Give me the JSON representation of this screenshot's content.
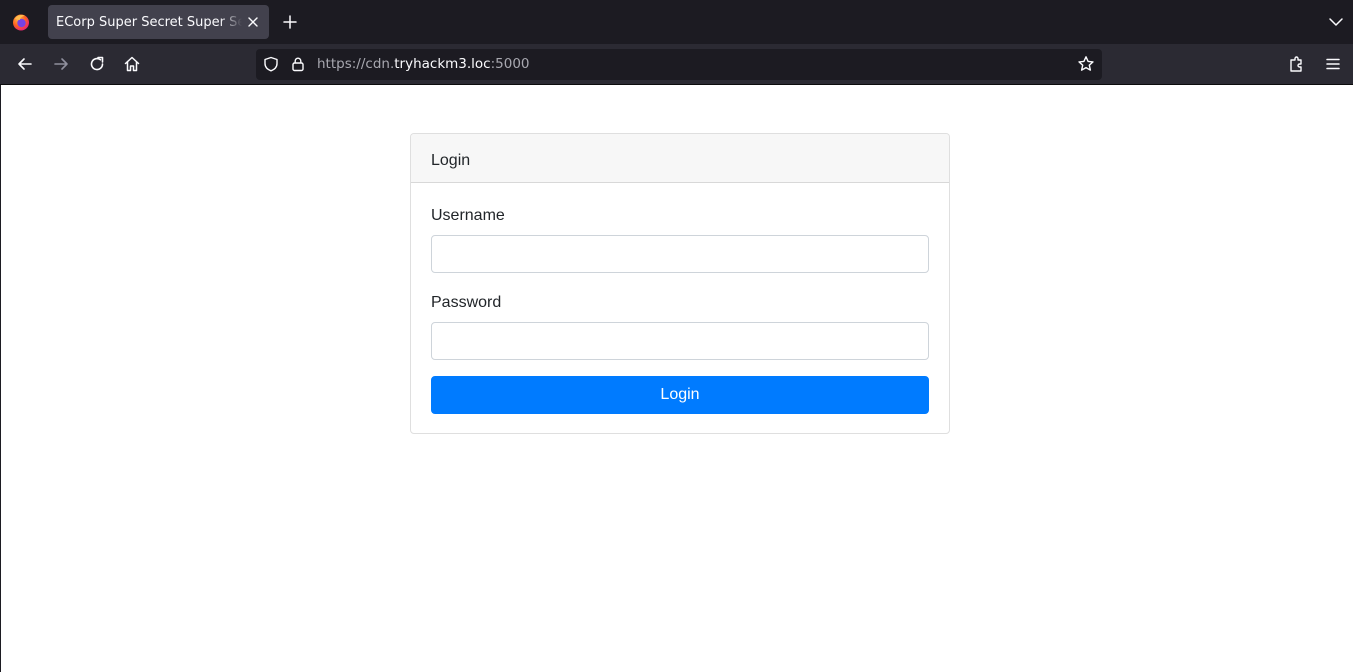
{
  "browser": {
    "tab_title": "ECorp Super Secret Super Secret",
    "url_prefix": "https://cdn.",
    "url_host": "tryhackm3.loc",
    "url_suffix": ":5000"
  },
  "login_card": {
    "header": "Login",
    "username_label": "Username",
    "username_value": "",
    "password_label": "Password",
    "password_value": "",
    "submit_label": "Login"
  },
  "colors": {
    "primary_button": "#007bff",
    "chrome_dark": "#1c1b22",
    "toolbar": "#2b2a33"
  }
}
